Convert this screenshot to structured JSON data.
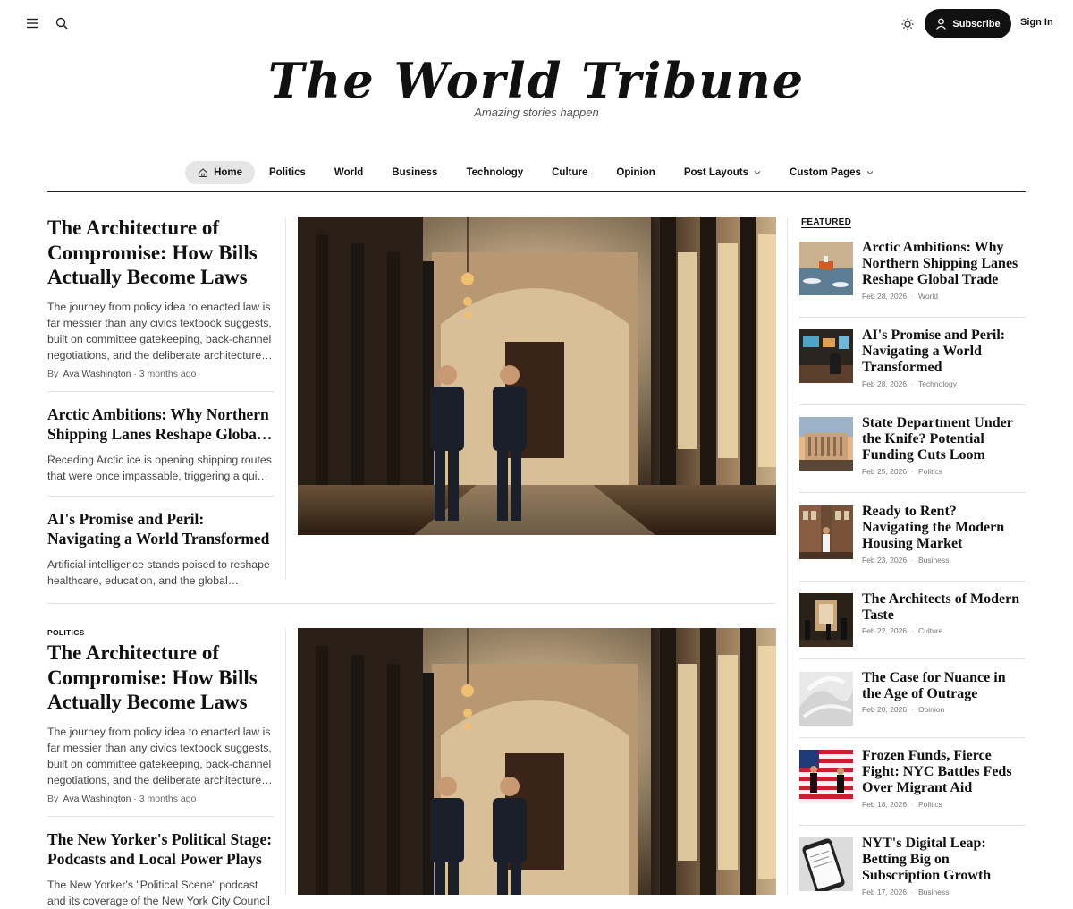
{
  "header": {
    "subscribe_label": "Subscribe",
    "signin_label": "Sign In",
    "icons": [
      "menu-icon",
      "search-icon",
      "sun-icon",
      "user-icon"
    ]
  },
  "masthead": {
    "title": "The World Tribune",
    "tagline": "Amazing stories happen"
  },
  "nav": {
    "items": [
      {
        "label": "Home"
      },
      {
        "label": "Politics"
      },
      {
        "label": "World"
      },
      {
        "label": "Business"
      },
      {
        "label": "Technology"
      },
      {
        "label": "Culture"
      },
      {
        "label": "Opinion"
      },
      {
        "label": "Post Layouts"
      },
      {
        "label": "Custom Pages"
      }
    ]
  },
  "block1": {
    "lead": {
      "title": "The Architecture of Compromise: How Bills Actually Become Laws",
      "excerpt": "The journey from policy idea to enacted law is far messier than any civics textbook suggests, built on committee gatekeeping, back-channel negotiations, and the deliberate architecture of compromise.",
      "by": "By",
      "author": "Ava Washington",
      "time": "· 3 months ago"
    },
    "items": [
      {
        "title": "Arctic Ambitions: Why Northern Shipping Lanes Reshape Global Trade",
        "excerpt": "Receding Arctic ice is opening shipping routes that were once impassable, triggering a quiet scramble among nations."
      },
      {
        "title": "AI's Promise and Peril: Navigating a World Transformed",
        "excerpt": "Artificial intelligence stands poised to reshape healthcare, education, and the global economy."
      }
    ]
  },
  "block2": {
    "category": "POLITICS",
    "lead": {
      "title": "The Architecture of Compromise: How Bills Actually Become Laws",
      "excerpt": "The journey from policy idea to enacted law is far messier than any civics textbook suggests, built on committee gatekeeping, back-channel negotiations, and the deliberate architecture of compromise.",
      "by": "By",
      "author": "Ava Washington",
      "time": "· 3 months ago"
    },
    "items": [
      {
        "title": "The New Yorker's Political Stage: Podcasts and Local Power Plays",
        "excerpt": "The New Yorker's \"Political Scene\" podcast and its coverage of the New York City Council"
      }
    ]
  },
  "featured": {
    "label": "FEATURED",
    "items": [
      {
        "title": "Arctic Ambitions: Why Northern Shipping Lanes Reshape Global Trade",
        "date": "Feb 28, 2026",
        "category": "World"
      },
      {
        "title": "AI's Promise and Peril: Navigating a World Transformed",
        "date": "Feb 28, 2026",
        "category": "Technology"
      },
      {
        "title": "State Department Under the Knife? Potential Funding Cuts Loom",
        "date": "Feb 25, 2026",
        "category": "Politics"
      },
      {
        "title": "Ready to Rent? Navigating the Modern Housing Market",
        "date": "Feb 23, 2026",
        "category": "Business"
      },
      {
        "title": "The Architects of Modern Taste",
        "date": "Feb 22, 2026",
        "category": "Culture"
      },
      {
        "title": "The Case for Nuance in the Age of Outrage",
        "date": "Feb 20, 2026",
        "category": "Opinion"
      },
      {
        "title": "Frozen Funds, Fierce Fight: NYC Battles Feds Over Migrant Aid",
        "date": "Feb 18, 2026",
        "category": "Politics"
      },
      {
        "title": "NYT's Digital Leap: Betting Big on Subscription Growth",
        "date": "Feb 17, 2026",
        "category": "Business"
      }
    ]
  }
}
